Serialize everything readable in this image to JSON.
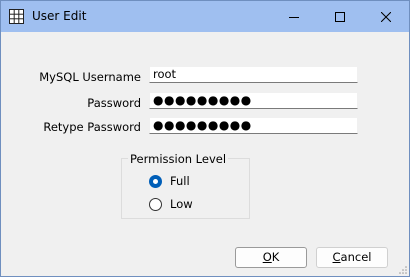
{
  "window": {
    "title": "User Edit",
    "icon": "table-grid-icon",
    "controls": [
      "minimize-icon",
      "maximize-icon",
      "close-icon"
    ]
  },
  "form": {
    "username_label": "MySQL Username",
    "username_value": "root",
    "password_label": "Password",
    "password_value": "●●●●●●●●●",
    "retype_label": "Retype Password",
    "retype_value": "●●●●●●●●●"
  },
  "permission": {
    "legend": "Permission Level",
    "options": [
      {
        "label": "Full",
        "checked": true
      },
      {
        "label": "Low",
        "checked": false
      }
    ]
  },
  "buttons": {
    "ok_label": "OK",
    "ok_mnemonic": "O",
    "ok_rest": "K",
    "cancel_label": "Cancel",
    "cancel_mnemonic": "C",
    "cancel_rest": "ancel"
  },
  "colors": {
    "titlebar": "#9fbff0",
    "body": "#f0f0f0",
    "accent": "#005fb8"
  }
}
